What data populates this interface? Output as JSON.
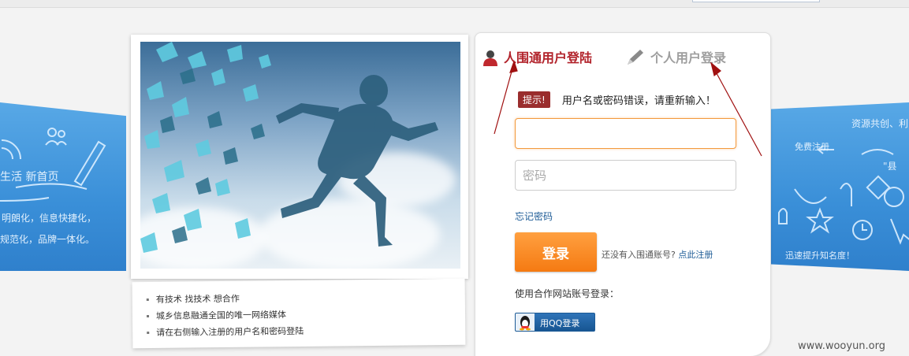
{
  "tabs": {
    "active_label": "人围通用户登陆",
    "inactive_label": "个人用户登录"
  },
  "notice": {
    "badge": "提示!",
    "message": "用户名或密码错误，请重新输入！"
  },
  "form": {
    "username_value": "",
    "password_placeholder": "密码",
    "forgot_label": "忘记密码",
    "login_label": "登录",
    "register_prompt": "还没有入围通账号?",
    "register_link": "点此注册",
    "coop_label": "使用合作网站账号登录：",
    "qq_label": "用QQ登录"
  },
  "caption": {
    "items": [
      "有技术 找技术 想合作",
      "城乡信息融通全国的唯一网络媒体",
      "请在右侧输入注册的用户名和密码登陆"
    ]
  },
  "banner_left": {
    "line1": "生活 新首页",
    "line2": "明朗化，信息快捷化，",
    "line3": "规范化，品牌一体化。"
  },
  "banner_right": {
    "line1": "资源共创、利",
    "line2": "免费注册",
    "line3": "\"县",
    "line4": "迅速提升知名度！"
  },
  "watermark": "www.wooyun.org",
  "colors": {
    "accent_red": "#b2232b",
    "button_orange": "#f57a12",
    "link_blue": "#1d5b96",
    "band_blue": "#3a8fd8"
  },
  "icons": {
    "user_tab": "user-avatar-icon",
    "personal_tab": "pencil-icon",
    "qq": "qq-penguin-icon"
  }
}
